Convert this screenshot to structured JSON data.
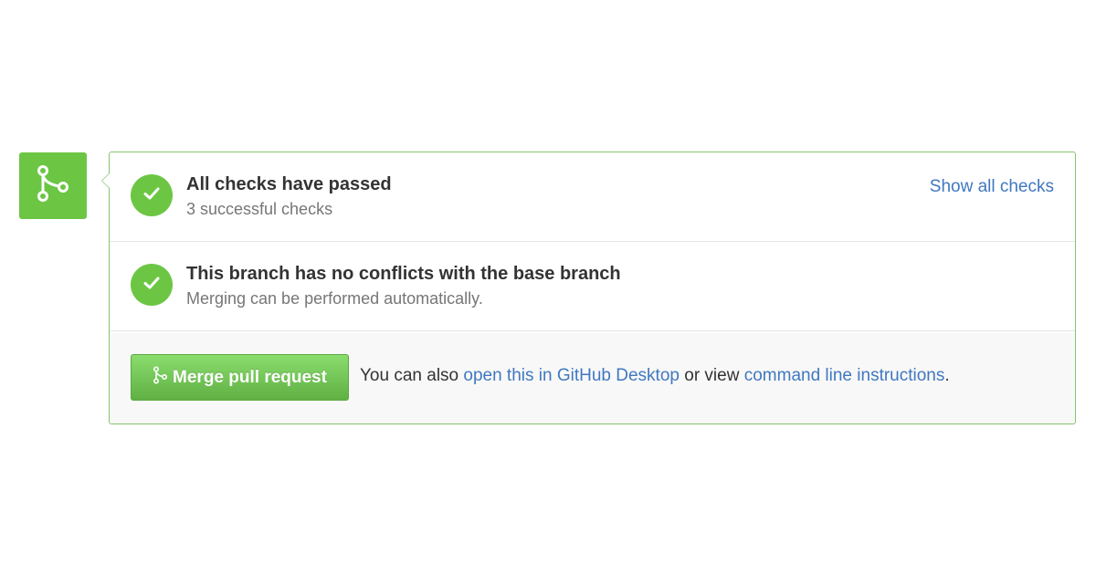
{
  "checks_section": {
    "title": "All checks have passed",
    "subtitle": "3 successful checks",
    "show_all_link": "Show all checks"
  },
  "conflicts_section": {
    "title": "This branch has no conflicts with the base branch",
    "subtitle": "Merging can be performed automatically."
  },
  "footer": {
    "merge_button_label": "Merge pull request",
    "text_prefix": "You can also ",
    "desktop_link": "open this in GitHub Desktop",
    "text_middle": " or view ",
    "cli_link": "command line instructions",
    "text_suffix": "."
  },
  "icons": {
    "badge": "git-merge-icon",
    "check": "check-icon"
  },
  "colors": {
    "success_green": "#6cc644",
    "link_blue": "#4078c0",
    "border_green": "#86c56b"
  }
}
